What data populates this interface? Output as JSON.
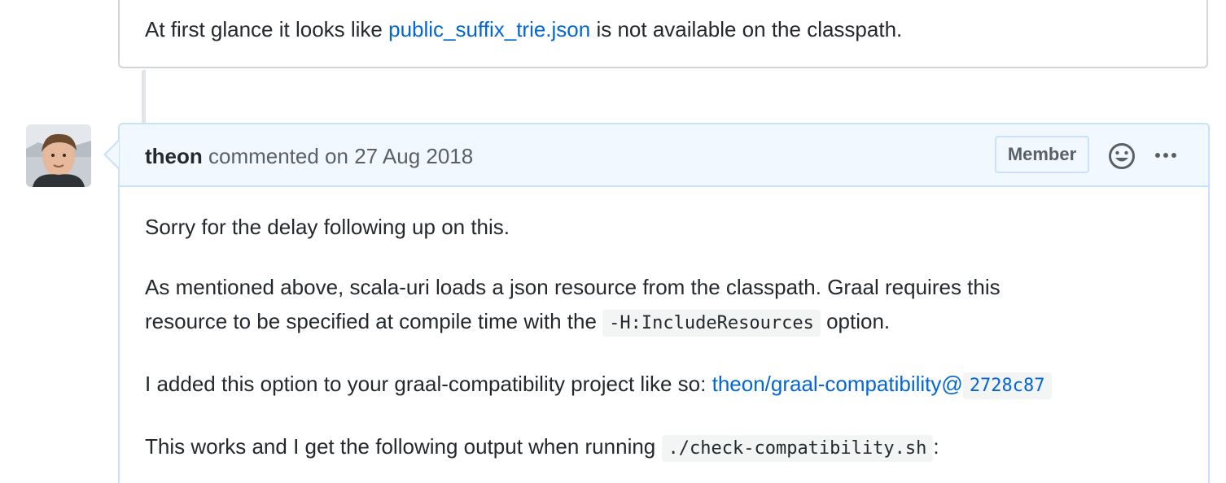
{
  "previous_comment": {
    "text_before": "At first glance it looks like ",
    "link_text": "public_suffix_trie.json",
    "text_after": " is not available on the classpath."
  },
  "comment": {
    "author": "theon",
    "meta": " commented on 27 Aug 2018",
    "badge": "Member",
    "icons": {
      "avatar": "user-avatar",
      "reaction": "smiley-icon",
      "more": "kebab-horizontal-icon"
    },
    "body": {
      "p1": "Sorry for the delay following up on this.",
      "p2_line1": "As mentioned above, scala-uri loads a json resource from the classpath. Graal requires this",
      "p2_line2_before": "resource to be specified at compile time with the ",
      "p2_code": "-H:IncludeResources",
      "p2_line2_after": " option.",
      "p3_before": "I added this option to your graal-compatibility project like so: ",
      "p3_link": "theon/graal-compatibility@",
      "p3_commit": "2728c87",
      "p4_before": "This works and I get the following output when running ",
      "p4_code": "./check-compatibility.sh",
      "p4_after": ":"
    }
  },
  "colors": {
    "link": "#0366d6",
    "header_bg": "#f1f8ff",
    "border": "#c8e1ff",
    "text": "#24292e",
    "muted": "#586069"
  }
}
